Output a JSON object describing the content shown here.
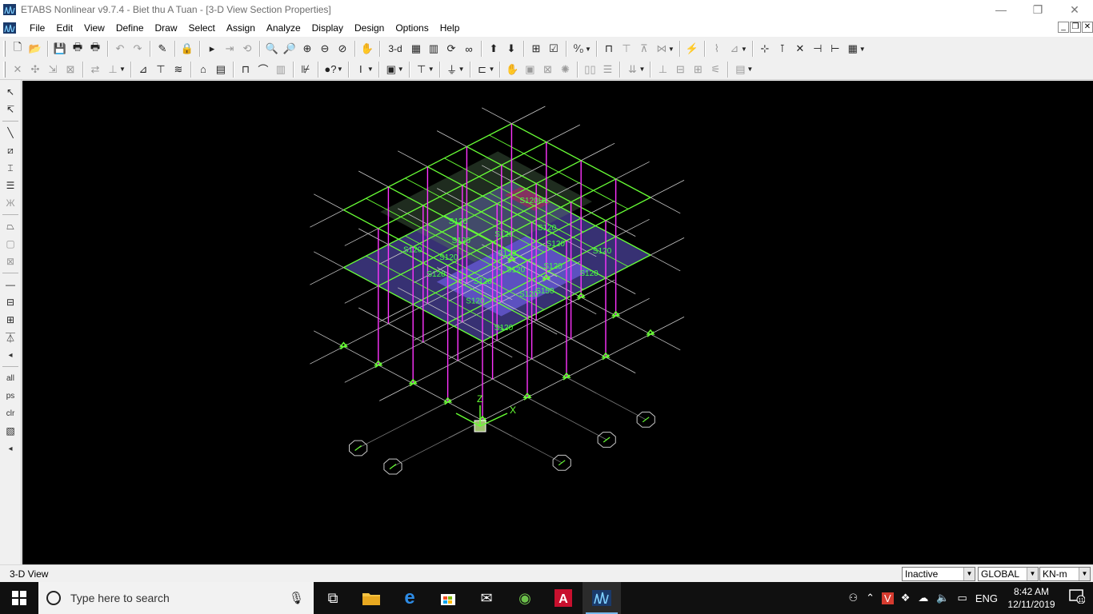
{
  "window": {
    "title": "ETABS Nonlinear v9.7.4 - Biet thu A Tuan - [3-D View  Section Properties]",
    "minimize": "—",
    "maximize": "❐",
    "close": "✕"
  },
  "menu": [
    "File",
    "Edit",
    "View",
    "Define",
    "Draw",
    "Select",
    "Assign",
    "Analyze",
    "Display",
    "Design",
    "Options",
    "Help"
  ],
  "mdi_controls": [
    "_",
    "❐",
    "✕"
  ],
  "toolbar1": {
    "view_3d": "3-d",
    "percent": "⁰⁄₀"
  },
  "left_toolbar": {
    "all": "all",
    "ps": "ps",
    "clr": "clr"
  },
  "viewport": {
    "background": "#000000",
    "labels": [
      "S120",
      "S120",
      "S120",
      "S120",
      "S120",
      "S120",
      "S120",
      "S120",
      "S120",
      "S120",
      "S150",
      "S120",
      "S120",
      "S120HL",
      "S120",
      "S120",
      "S120",
      "S120",
      "S120"
    ],
    "axes": {
      "z": "Z",
      "x": "X"
    },
    "colors": {
      "grid": "#c8c8c8",
      "beam": "#66ff33",
      "column": "#ff33ff",
      "slab": "#7b6cff",
      "text": "#44ff44"
    }
  },
  "status": {
    "view_name": "3-D View",
    "mode": "Inactive",
    "coord_system": "GLOBAL",
    "units": "KN-m"
  },
  "taskbar": {
    "search_placeholder": "Type here to search",
    "language": "ENG",
    "time": "8:42 AM",
    "date": "12/11/2019",
    "notifications": "11"
  }
}
